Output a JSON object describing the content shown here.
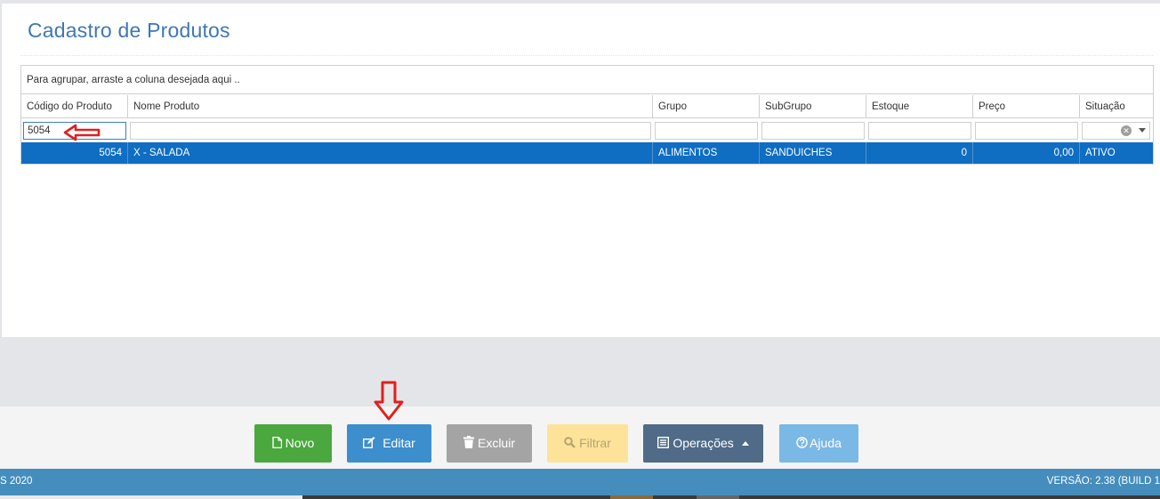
{
  "page": {
    "title": "Cadastro de Produtos"
  },
  "grid": {
    "group_hint": "Para agrupar, arraste a coluna desejada aqui ..",
    "columns": [
      "Código do Produto",
      "Nome Produto",
      "Grupo",
      "SubGrupo",
      "Estoque",
      "Preço",
      "Situação"
    ],
    "filters": {
      "codigo": "5054",
      "nome": "",
      "grupo": "",
      "subgrupo": "",
      "estoque": "",
      "preco": "",
      "situacao": ""
    },
    "rows": [
      {
        "codigo": "5054",
        "nome": "X - SALADA",
        "grupo": "ALIMENTOS",
        "subgrupo": "SANDUICHES",
        "estoque": "0",
        "preco": "0,00",
        "situacao": "ATIVO"
      }
    ]
  },
  "toolbar": {
    "novo": "Novo",
    "editar": "Editar",
    "excluir": "Excluir",
    "filtrar": "Filtrar",
    "operacoes": "Operações",
    "ajuda": "Ajuda"
  },
  "footer": {
    "left": "S 2020",
    "right": "VERSÃO: 2.38 (BUILD 1"
  },
  "colors": {
    "title": "#3f78b2",
    "selected_row": "#0f6dc2",
    "novo": "#4aa83e",
    "editar": "#3c8ecd",
    "excluir": "#a4a4a4",
    "filtrar": "#fde39a",
    "operacoes": "#4f6b87",
    "ajuda": "#7ab8e6",
    "footer": "#458dbd",
    "annotation": "#e0201c"
  },
  "icons": {
    "novo": "file-icon",
    "editar": "edit-icon",
    "excluir": "trash-icon",
    "filtrar": "search-icon",
    "operacoes": "list-icon",
    "ajuda": "help-icon"
  }
}
